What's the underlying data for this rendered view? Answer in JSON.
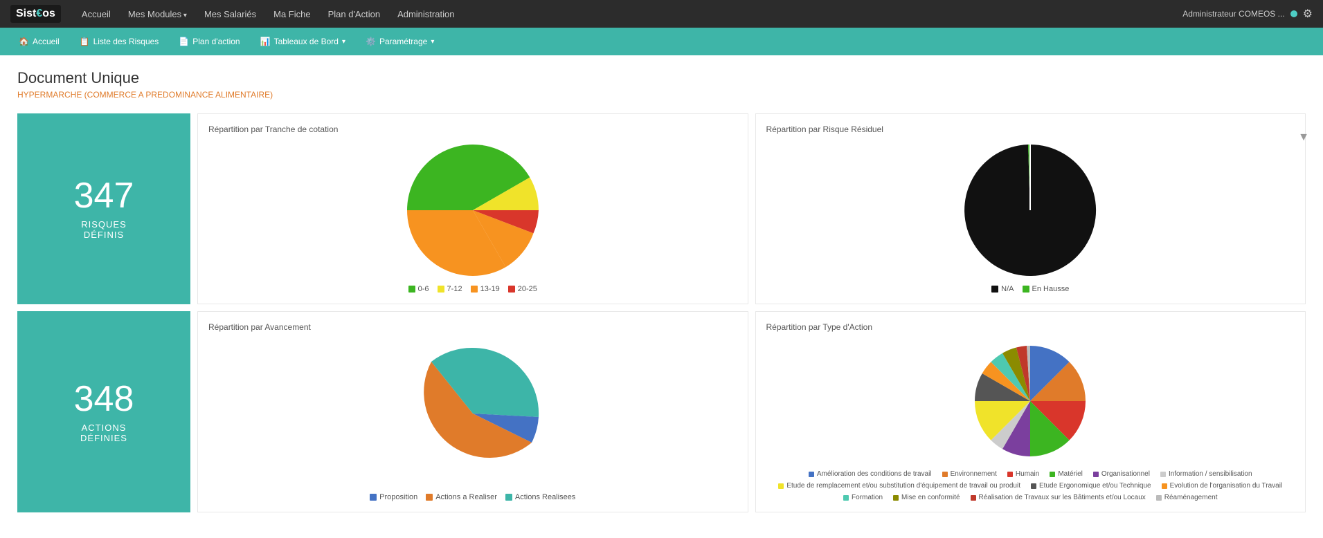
{
  "topNav": {
    "logo": "Sist€os",
    "links": [
      {
        "label": "Accueil",
        "hasDropdown": false
      },
      {
        "label": "Mes Modules",
        "hasDropdown": true
      },
      {
        "label": "Mes Salariés",
        "hasDropdown": false
      },
      {
        "label": "Ma Fiche",
        "hasDropdown": false
      },
      {
        "label": "Plan d'Action",
        "hasDropdown": false
      },
      {
        "label": "Administration",
        "hasDropdown": false
      }
    ],
    "user": "Administrateur COMEOS ..."
  },
  "secondNav": {
    "items": [
      {
        "label": "Accueil",
        "icon": "🏠"
      },
      {
        "label": "Liste des Risques",
        "icon": "📋"
      },
      {
        "label": "Plan d'action",
        "icon": "📄"
      },
      {
        "label": "Tableaux de Bord",
        "icon": "📊",
        "hasDropdown": true
      },
      {
        "label": "Paramétrage",
        "icon": "⚙️",
        "hasDropdown": true
      }
    ]
  },
  "page": {
    "title": "Document Unique",
    "subtitle": "HYPERMARCHE (COMMERCE A PREDOMINANCE ALIMENTAIRE)"
  },
  "cards": {
    "risques": {
      "number": "347",
      "label": "RISQUES\nDÉFINIS"
    },
    "actions": {
      "number": "348",
      "label": "ACTIONS\nDÉFINIES"
    }
  },
  "charts": {
    "tranche": {
      "title": "Répartition par Tranche de cotation",
      "legend": [
        {
          "label": "0-6",
          "color": "#3cb521"
        },
        {
          "label": "7-12",
          "color": "#f0e32a"
        },
        {
          "label": "13-19",
          "color": "#f79320"
        },
        {
          "label": "20-25",
          "color": "#d9362b"
        }
      ]
    },
    "residuel": {
      "title": "Répartition par Risque Résiduel",
      "legend": [
        {
          "label": "N/A",
          "color": "#111111"
        },
        {
          "label": "En Hausse",
          "color": "#3cb521"
        }
      ]
    },
    "avancement": {
      "title": "Répartition par Avancement",
      "legend": [
        {
          "label": "Proposition",
          "color": "#4472c4"
        },
        {
          "label": "Actions a Realiser",
          "color": "#e07b2a"
        },
        {
          "label": "Actions Realisees",
          "color": "#3db5a8"
        }
      ]
    },
    "typeAction": {
      "title": "Répartition par Type d'Action",
      "legend": [
        {
          "label": "Amélioration des conditions de travail",
          "color": "#4472c4"
        },
        {
          "label": "Environnement",
          "color": "#e07b2a"
        },
        {
          "label": "Humain",
          "color": "#d9362b"
        },
        {
          "label": "Matériel",
          "color": "#3cb521"
        },
        {
          "label": "Organisationnel",
          "color": "#7b3f9e"
        },
        {
          "label": "Information / sensibilisation",
          "color": "#ccc"
        },
        {
          "label": "Etude de remplacement et/ou substitution d'équipement de travail ou produit",
          "color": "#f0e32a"
        },
        {
          "label": "Etude Ergonomique et/ou Technique",
          "color": "#555"
        },
        {
          "label": "Evolution de l'organisation du Travail",
          "color": "#f79320"
        },
        {
          "label": "Formation",
          "color": "#4ec9b0"
        },
        {
          "label": "Mise en conformité",
          "color": "#8b8b00"
        },
        {
          "label": "Réalisation de Travaux sur les Bâtiments et/ou Locaux",
          "color": "#c0392b"
        },
        {
          "label": "Réaménagement",
          "color": "#bbb"
        }
      ]
    }
  }
}
